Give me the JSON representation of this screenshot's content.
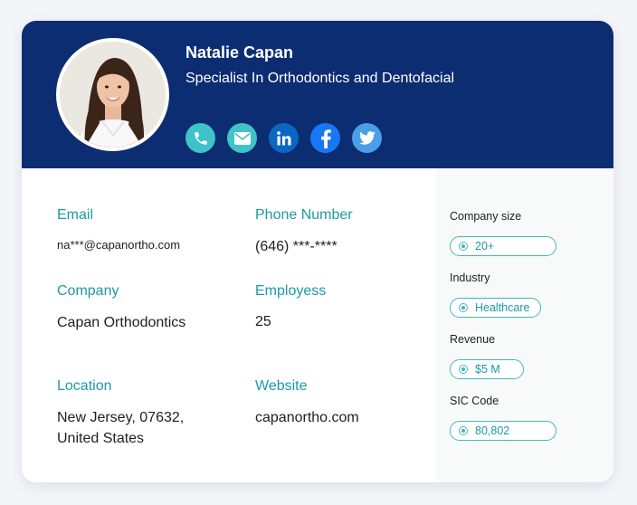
{
  "profile": {
    "name": "Natalie Capan",
    "title": "Specialist In Orthodontics and Dentofacial"
  },
  "socials": [
    {
      "icon": "phone-icon",
      "color": "#3ec3c9"
    },
    {
      "icon": "mail-icon",
      "color": "#3ec3c9"
    },
    {
      "icon": "linkedin-icon",
      "color": "#0a66c2"
    },
    {
      "icon": "facebook-icon",
      "color": "#1877f2"
    },
    {
      "icon": "twitter-icon",
      "color": "#4a9fe8"
    }
  ],
  "fields": {
    "email": {
      "label": "Email",
      "value": "na***@capanortho.com"
    },
    "phone": {
      "label": "Phone Number",
      "value": "(646) ***-****"
    },
    "company": {
      "label": "Company",
      "value": "Capan Orthodontics"
    },
    "employees": {
      "label": "Employess",
      "value": "25"
    },
    "location": {
      "label": "Location",
      "value": "New Jersey, 07632, United States"
    },
    "website": {
      "label": "Website",
      "value": "capanortho.com"
    }
  },
  "side": {
    "company_size": {
      "label": "Company size",
      "value": "20+"
    },
    "industry": {
      "label": "Industry",
      "value": "Healthcare"
    },
    "revenue": {
      "label": "Revenue",
      "value": "$5 M"
    },
    "sic_code": {
      "label": "SIC Code",
      "value": "80,802"
    }
  },
  "colors": {
    "header": "#0c2d71",
    "accent": "#1c9aa5",
    "pill_border": "#43b7bd",
    "background": "#f3f5f9"
  }
}
